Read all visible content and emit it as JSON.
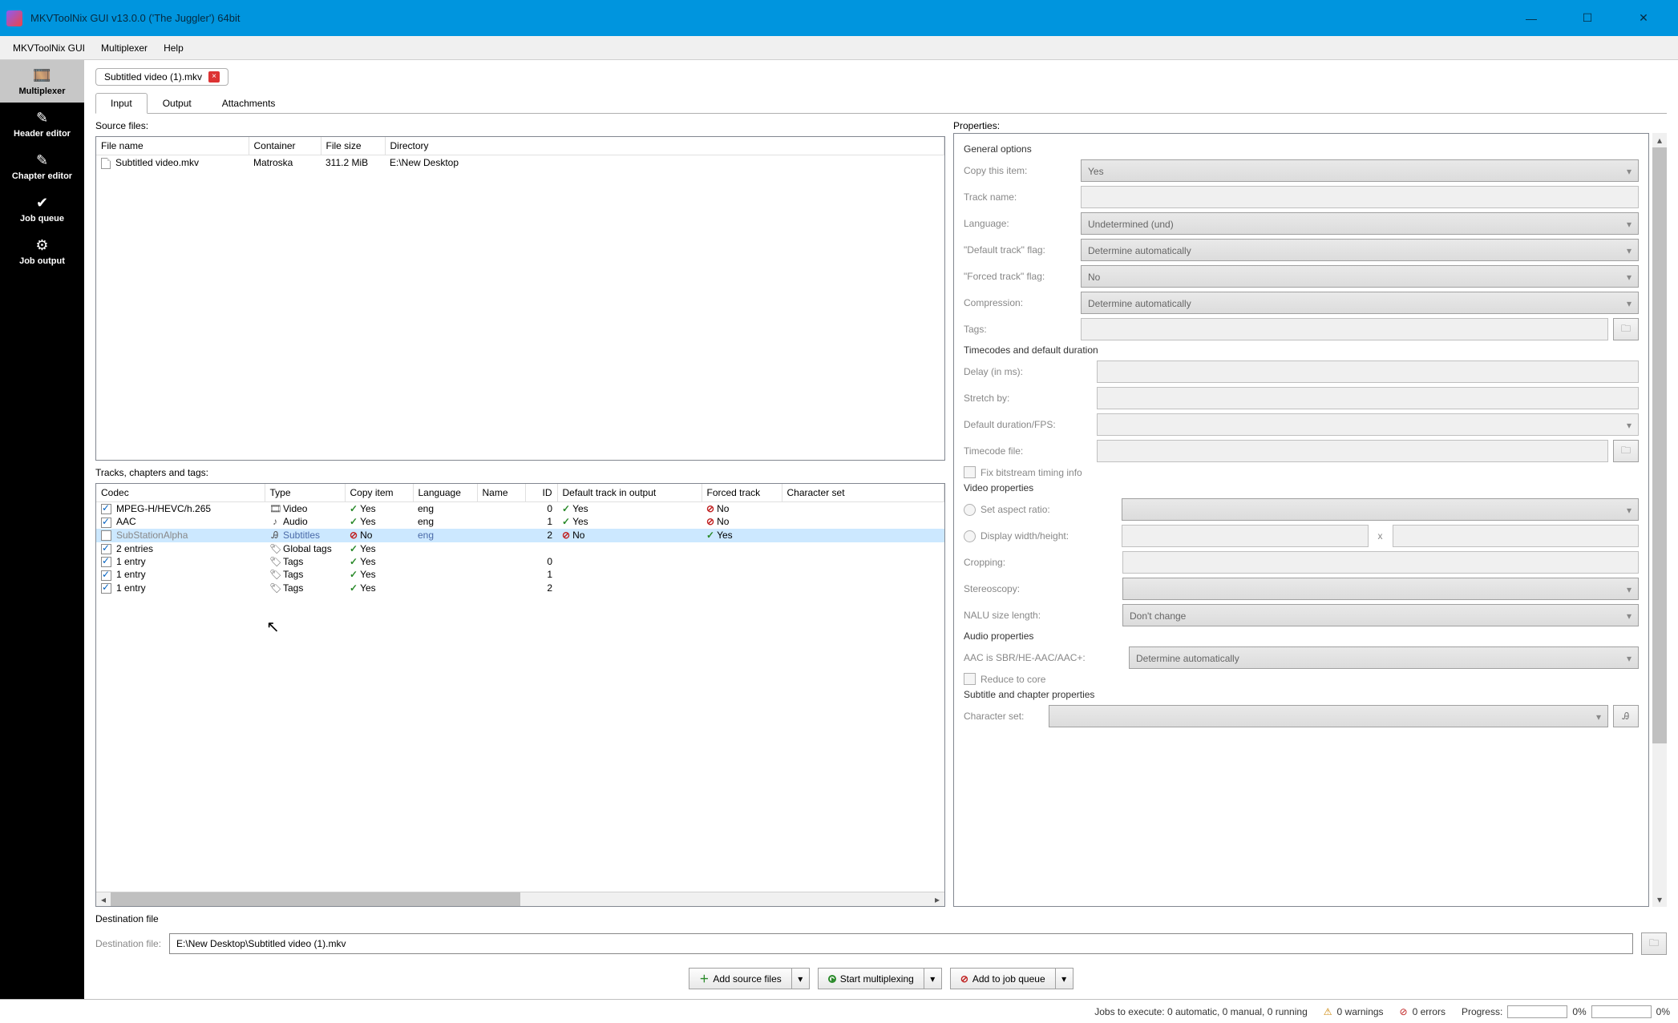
{
  "title": "MKVToolNix GUI v13.0.0 ('The Juggler') 64bit",
  "menubar": [
    "MKVToolNix GUI",
    "Multiplexer",
    "Help"
  ],
  "sidebar": [
    {
      "label": "Multiplexer",
      "selected": true
    },
    {
      "label": "Header editor",
      "selected": false
    },
    {
      "label": "Chapter editor",
      "selected": false
    },
    {
      "label": "Job queue",
      "selected": false
    },
    {
      "label": "Job output",
      "selected": false
    }
  ],
  "fileTab": {
    "label": "Subtitled video (1).mkv"
  },
  "subTabs": [
    "Input",
    "Output",
    "Attachments"
  ],
  "sourceFilesLabel": "Source files:",
  "sourceHeaders": [
    "File name",
    "Container",
    "File size",
    "Directory"
  ],
  "sourceRows": [
    {
      "name": "Subtitled video.mkv",
      "container": "Matroska",
      "size": "311.2 MiB",
      "dir": "E:\\New Desktop"
    }
  ],
  "tracksLabel": "Tracks, chapters and tags:",
  "trackHeaders": [
    "Codec",
    "Type",
    "Copy item",
    "Language",
    "Name",
    "ID",
    "Default track in output",
    "Forced track",
    "Character set"
  ],
  "tracks": [
    {
      "checked": true,
      "codec": "MPEG-H/HEVC/h.265",
      "type": "Video",
      "copy": "Yes",
      "lang": "eng",
      "name": "",
      "id": "0",
      "def": "Yes",
      "forced": "No",
      "dim": false,
      "selected": false
    },
    {
      "checked": true,
      "codec": "AAC",
      "type": "Audio",
      "copy": "Yes",
      "lang": "eng",
      "name": "",
      "id": "1",
      "def": "Yes",
      "forced": "No",
      "dim": false,
      "selected": false
    },
    {
      "checked": false,
      "codec": "SubStationAlpha",
      "type": "Subtitles",
      "copy": "No",
      "lang": "eng",
      "name": "",
      "id": "2",
      "def": "No",
      "forced": "Yes",
      "dim": true,
      "selected": true
    },
    {
      "checked": true,
      "codec": "2 entries",
      "type": "Global tags",
      "copy": "Yes",
      "lang": "",
      "name": "",
      "id": "",
      "def": "",
      "forced": "",
      "dim": false,
      "selected": false
    },
    {
      "checked": true,
      "codec": "1 entry",
      "type": "Tags",
      "copy": "Yes",
      "lang": "",
      "name": "",
      "id": "0",
      "def": "",
      "forced": "",
      "dim": false,
      "selected": false
    },
    {
      "checked": true,
      "codec": "1 entry",
      "type": "Tags",
      "copy": "Yes",
      "lang": "",
      "name": "",
      "id": "1",
      "def": "",
      "forced": "",
      "dim": false,
      "selected": false
    },
    {
      "checked": true,
      "codec": "1 entry",
      "type": "Tags",
      "copy": "Yes",
      "lang": "",
      "name": "",
      "id": "2",
      "def": "",
      "forced": "",
      "dim": false,
      "selected": false
    }
  ],
  "propertiesLabel": "Properties:",
  "general": {
    "title": "General options",
    "copyItem": {
      "label": "Copy this item:",
      "value": "Yes"
    },
    "trackName": {
      "label": "Track name:",
      "value": ""
    },
    "language": {
      "label": "Language:",
      "value": "Undetermined (und)"
    },
    "defaultFlag": {
      "label": "\"Default track\" flag:",
      "value": "Determine automatically"
    },
    "forcedFlag": {
      "label": "\"Forced track\" flag:",
      "value": "No"
    },
    "compression": {
      "label": "Compression:",
      "value": "Determine automatically"
    },
    "tags": {
      "label": "Tags:",
      "value": ""
    }
  },
  "timecodes": {
    "title": "Timecodes and default duration",
    "delay": {
      "label": "Delay (in ms):",
      "value": ""
    },
    "stretch": {
      "label": "Stretch by:",
      "value": ""
    },
    "fps": {
      "label": "Default duration/FPS:",
      "value": ""
    },
    "file": {
      "label": "Timecode file:",
      "value": ""
    },
    "fixBitstream": {
      "label": "Fix bitstream timing info"
    }
  },
  "video": {
    "title": "Video properties",
    "aspect": {
      "label": "Set aspect ratio:",
      "value": ""
    },
    "display": {
      "label": "Display width/height:",
      "w": "",
      "h": ""
    },
    "cropping": {
      "label": "Cropping:",
      "value": ""
    },
    "stereo": {
      "label": "Stereoscopy:",
      "value": ""
    },
    "nalu": {
      "label": "NALU size length:",
      "value": "Don't change"
    }
  },
  "audio": {
    "title": "Audio properties",
    "aac": {
      "label": "AAC is SBR/HE-AAC/AAC+:",
      "value": "Determine automatically"
    },
    "reduce": {
      "label": "Reduce to core"
    }
  },
  "subtitle": {
    "title": "Subtitle and chapter properties",
    "charset": {
      "label": "Character set:",
      "value": ""
    }
  },
  "destSection": "Destination file",
  "destLabel": "Destination file:",
  "destValue": "E:\\New Desktop\\Subtitled video (1).mkv",
  "buttons": {
    "addSource": "Add source files",
    "start": "Start multiplexing",
    "addQueue": "Add to job queue"
  },
  "status": {
    "jobs": "Jobs to execute: 0 automatic, 0 manual, 0 running",
    "warnings": "0 warnings",
    "errors": "0 errors",
    "progressLabel": "Progress:",
    "progress": "0%"
  }
}
